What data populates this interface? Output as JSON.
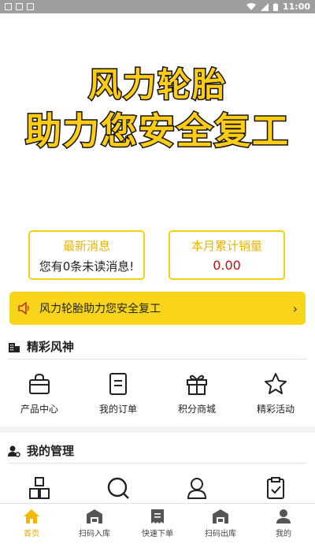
{
  "status_bar": {
    "time": "11:00"
  },
  "banner": {
    "line1": "风力轮胎",
    "line2": "助力您安全复工"
  },
  "stats": {
    "messages": {
      "title": "最新消息",
      "value": "您有0条未读消息!"
    },
    "sales": {
      "title": "本月累计销量",
      "value": "0.00"
    }
  },
  "notice": {
    "text": "风力轮胎助力您安全复工",
    "chevron": "›"
  },
  "section_featured": {
    "title": "精彩风神",
    "items": [
      {
        "label": "产品中心",
        "icon": "basket-icon"
      },
      {
        "label": "我的订单",
        "icon": "document-icon"
      },
      {
        "label": "积分商城",
        "icon": "gift-icon"
      },
      {
        "label": "精彩活动",
        "icon": "star-icon"
      }
    ]
  },
  "section_manage": {
    "title": "我的管理",
    "items": [
      {
        "icon": "boxes-icon"
      },
      {
        "icon": "search-icon"
      },
      {
        "icon": "person-icon"
      },
      {
        "icon": "clipboard-check-icon"
      }
    ]
  },
  "tabbar": {
    "tabs": [
      {
        "label": "首页",
        "icon": "home-icon",
        "active": true
      },
      {
        "label": "扫码入库",
        "icon": "warehouse-in-icon"
      },
      {
        "label": "快速下单",
        "icon": "receipt-icon"
      },
      {
        "label": "扫码出库",
        "icon": "warehouse-out-icon"
      },
      {
        "label": "我的",
        "icon": "user-icon"
      }
    ]
  },
  "colors": {
    "accent": "#f8d51a",
    "brand_yellow": "#ffcc14",
    "value_red": "#c01010",
    "tab_active": "#e5a800"
  }
}
